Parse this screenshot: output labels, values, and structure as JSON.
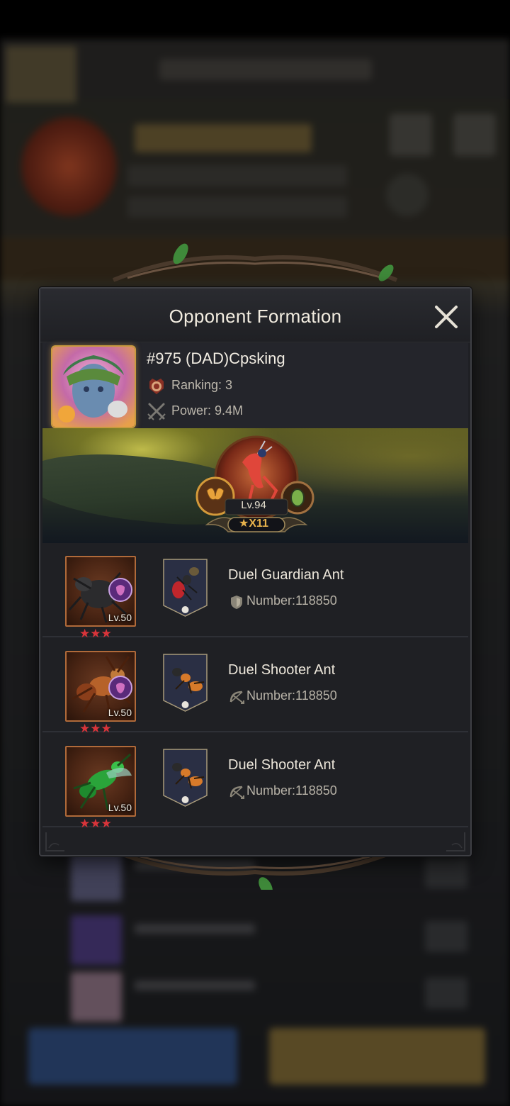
{
  "modal": {
    "title": "Opponent Formation",
    "close_icon": "close-icon"
  },
  "opponent": {
    "name": "#975 (DAD)Cpsking",
    "ranking": "Ranking: 3",
    "power": "Power: 9.4M",
    "ranking_icon": "rank-medal-icon",
    "power_icon": "crossed-swords-icon"
  },
  "hero": {
    "level": "Lv.94",
    "stars": "★X11",
    "skill_left_icon": "butterfly-icon",
    "skill_right_icon": "beetle-icon"
  },
  "troops": [
    {
      "name": "Duel Guardian Ant",
      "number": "Number:118850",
      "level": "Lv.50",
      "stars": 3,
      "type_icon": "shield-icon",
      "portrait_color": "#2b2b2d",
      "card_accent": "#c0262c"
    },
    {
      "name": "Duel Shooter Ant",
      "number": "Number:118850",
      "level": "Lv.50",
      "stars": 3,
      "type_icon": "bow-icon",
      "portrait_color": "#b6622a",
      "card_accent": "#d77a2a"
    },
    {
      "name": "Duel Shooter Ant",
      "number": "Number:118850",
      "level": "Lv.50",
      "stars": 3,
      "type_icon": "bow-icon",
      "portrait_color": "#2aa43a",
      "card_accent": "#d77a2a"
    }
  ],
  "colors": {
    "modal_bg": "#1f2024",
    "star_red": "#d8343a",
    "gold": "#e7b24c"
  }
}
